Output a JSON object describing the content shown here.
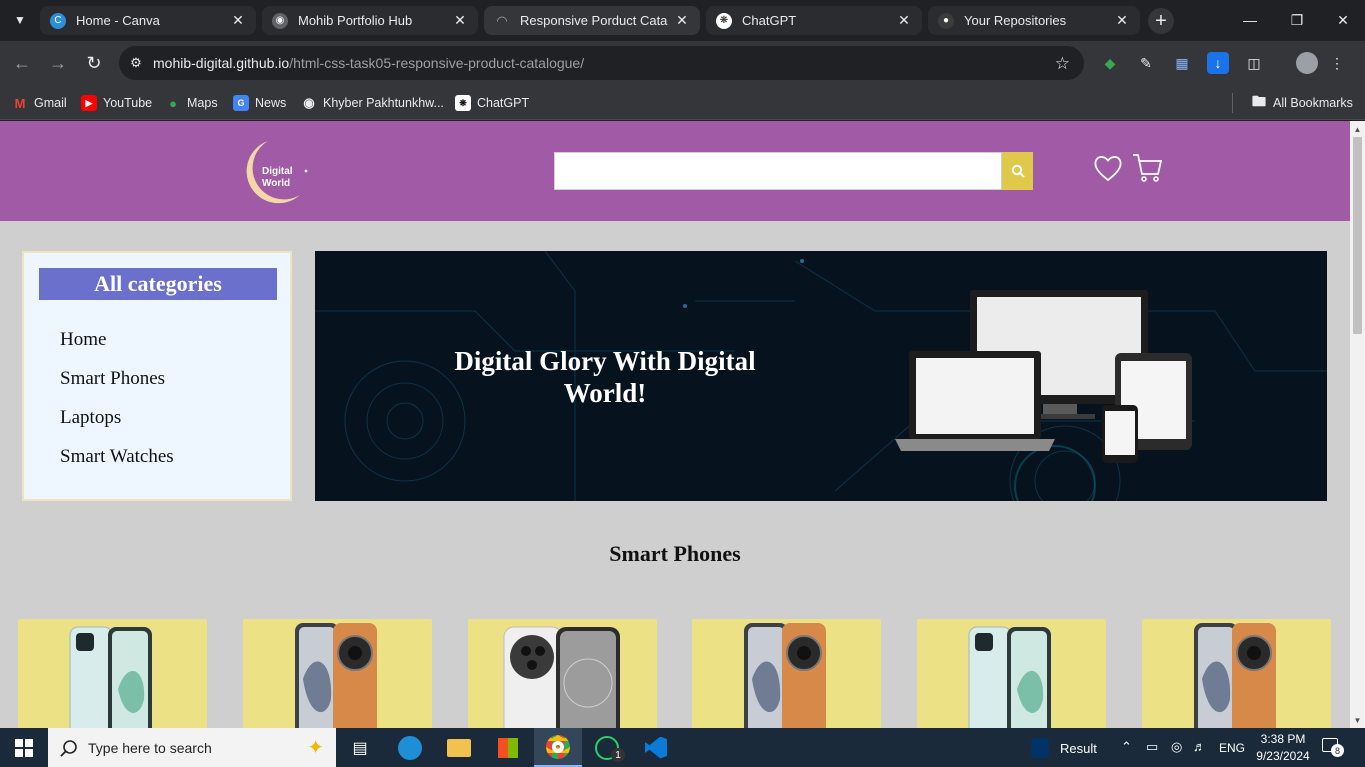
{
  "browser": {
    "tabs": [
      {
        "label": "Home - Canva",
        "icon": "canva-icon",
        "active": false
      },
      {
        "label": "Mohib Portfolio Hub",
        "icon": "globe-icon",
        "active": false
      },
      {
        "label": "Responsive Porduct Catalogue",
        "icon": "loading-icon",
        "active": true
      },
      {
        "label": "ChatGPT",
        "icon": "chatgpt-icon",
        "active": false
      },
      {
        "label": "Your Repositories",
        "icon": "github-icon",
        "active": false
      }
    ],
    "url_host": "mohib-digital.github.io",
    "url_path": "/html-css-task05-responsive-product-catalogue/",
    "bookmarks": [
      {
        "label": "Gmail",
        "icon": "gmail-icon"
      },
      {
        "label": "YouTube",
        "icon": "youtube-icon"
      },
      {
        "label": "Maps",
        "icon": "maps-icon"
      },
      {
        "label": "News",
        "icon": "news-icon"
      },
      {
        "label": "Khyber Pakhtunkhw...",
        "icon": "globe-icon"
      },
      {
        "label": "ChatGPT",
        "icon": "chatgpt-icon"
      }
    ],
    "all_bookmarks": "All Bookmarks"
  },
  "site": {
    "logo_line1": "Digital",
    "logo_line2": "World",
    "search_placeholder": "",
    "header_colors": {
      "bar": "#a05aa6",
      "search_button": "#e0c84a"
    },
    "categories_title": "All categories",
    "categories": [
      "Home",
      "Smart Phones",
      "Laptops",
      "Smart Watches"
    ],
    "banner_text": "Digital Glory With Digital World!",
    "section_title": "Smart Phones",
    "products": [
      "phone-teal",
      "phone-orange",
      "phone-white",
      "phone-orange",
      "phone-teal",
      "phone-orange"
    ]
  },
  "taskbar": {
    "search_placeholder": "Type here to search",
    "weather_label": "Result",
    "language": "ENG",
    "time": "3:38 PM",
    "date": "9/23/2024",
    "notifications": "8",
    "whatsapp_badge": "1"
  }
}
